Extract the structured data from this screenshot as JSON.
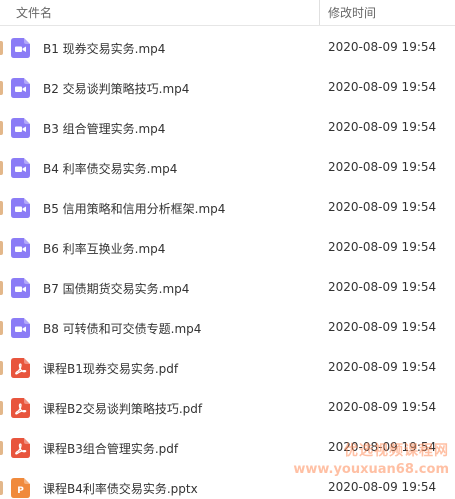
{
  "header": {
    "name_column": "文件名",
    "date_column": "修改时间"
  },
  "files": [
    {
      "name": "B1 现券交易实务.mp4",
      "modified": "2020-08-09 19:54",
      "icon": "video-file-icon",
      "type": "video"
    },
    {
      "name": "B2 交易谈判策略技巧.mp4",
      "modified": "2020-08-09 19:54",
      "icon": "video-file-icon",
      "type": "video"
    },
    {
      "name": "B3 组合管理实务.mp4",
      "modified": "2020-08-09 19:54",
      "icon": "video-file-icon",
      "type": "video"
    },
    {
      "name": "B4 利率债交易实务.mp4",
      "modified": "2020-08-09 19:54",
      "icon": "video-file-icon",
      "type": "video"
    },
    {
      "name": "B5 信用策略和信用分析框架.mp4",
      "modified": "2020-08-09 19:54",
      "icon": "video-file-icon",
      "type": "video"
    },
    {
      "name": "B6 利率互换业务.mp4",
      "modified": "2020-08-09 19:54",
      "icon": "video-file-icon",
      "type": "video"
    },
    {
      "name": "B7 国债期货交易实务.mp4",
      "modified": "2020-08-09 19:54",
      "icon": "video-file-icon",
      "type": "video"
    },
    {
      "name": "B8 可转债和可交债专题.mp4",
      "modified": "2020-08-09 19:54",
      "icon": "video-file-icon",
      "type": "video"
    },
    {
      "name": "课程B1现券交易实务.pdf",
      "modified": "2020-08-09 19:54",
      "icon": "pdf-file-icon",
      "type": "pdf"
    },
    {
      "name": "课程B2交易谈判策略技巧.pdf",
      "modified": "2020-08-09 19:54",
      "icon": "pdf-file-icon",
      "type": "pdf"
    },
    {
      "name": "课程B3组合管理实务.pdf",
      "modified": "2020-08-09 19:54",
      "icon": "pdf-file-icon",
      "type": "pdf"
    },
    {
      "name": "课程B4利率债交易实务.pptx",
      "modified": "2020-08-09 19:54",
      "icon": "pptx-file-icon",
      "type": "pptx"
    }
  ],
  "watermark": {
    "title": "优选视频课程网",
    "url": "www.youxuan68.com"
  },
  "colors": {
    "video": "#8b7cf6",
    "pdf": "#e8553d",
    "pptx": "#f08a3c",
    "row_marker": "#e3b78a",
    "header_text": "#666666",
    "text": "#333333"
  }
}
